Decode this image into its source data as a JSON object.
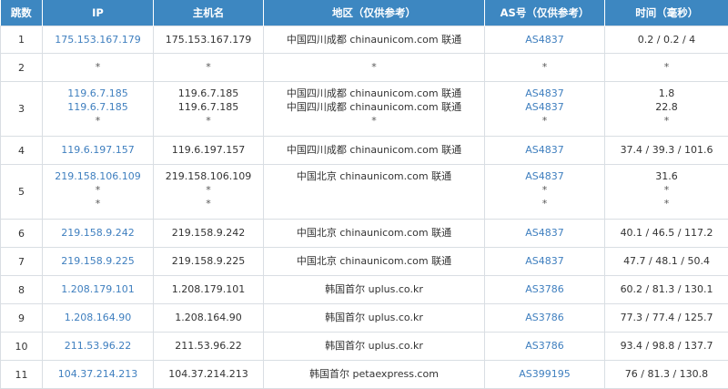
{
  "headers": {
    "hop": "跳数",
    "ip": "IP",
    "host": "主机名",
    "region": "地区（仅供参考）",
    "as": "AS号（仅供参考）",
    "time": "时间（毫秒）"
  },
  "rows": [
    {
      "hop": "1",
      "ip": [
        "175.153.167.179"
      ],
      "host": [
        "175.153.167.179"
      ],
      "region": [
        "中国四川成都 chinaunicom.com 联通"
      ],
      "as": [
        "AS4837"
      ],
      "time": [
        "0.2 / 0.2 / 4"
      ]
    },
    {
      "hop": "2",
      "ip": [
        "*"
      ],
      "host": [
        "*"
      ],
      "region": [
        "*"
      ],
      "as": [
        "*"
      ],
      "time": [
        "*"
      ]
    },
    {
      "hop": "3",
      "ip": [
        "119.6.7.185",
        "119.6.7.185",
        "*"
      ],
      "host": [
        "119.6.7.185",
        "119.6.7.185",
        "*"
      ],
      "region": [
        "中国四川成都 chinaunicom.com 联通",
        "中国四川成都 chinaunicom.com 联通",
        "*"
      ],
      "as": [
        "AS4837",
        "AS4837",
        "*"
      ],
      "time": [
        "1.8",
        "22.8",
        "*"
      ]
    },
    {
      "hop": "4",
      "ip": [
        "119.6.197.157"
      ],
      "host": [
        "119.6.197.157"
      ],
      "region": [
        "中国四川成都 chinaunicom.com 联通"
      ],
      "as": [
        "AS4837"
      ],
      "time": [
        "37.4 / 39.3 / 101.6"
      ]
    },
    {
      "hop": "5",
      "ip": [
        "219.158.106.109",
        "*",
        "*"
      ],
      "host": [
        "219.158.106.109",
        "*",
        "*"
      ],
      "region": [
        "中国北京 chinaunicom.com 联通"
      ],
      "as": [
        "AS4837",
        "*",
        "*"
      ],
      "time": [
        "31.6",
        "*",
        "*"
      ]
    },
    {
      "hop": "6",
      "ip": [
        "219.158.9.242"
      ],
      "host": [
        "219.158.9.242"
      ],
      "region": [
        "中国北京 chinaunicom.com 联通"
      ],
      "as": [
        "AS4837"
      ],
      "time": [
        "40.1 / 46.5 / 117.2"
      ]
    },
    {
      "hop": "7",
      "ip": [
        "219.158.9.225"
      ],
      "host": [
        "219.158.9.225"
      ],
      "region": [
        "中国北京 chinaunicom.com 联通"
      ],
      "as": [
        "AS4837"
      ],
      "time": [
        "47.7 / 48.1 / 50.4"
      ]
    },
    {
      "hop": "8",
      "ip": [
        "1.208.179.101"
      ],
      "host": [
        "1.208.179.101"
      ],
      "region": [
        "韩国首尔 uplus.co.kr"
      ],
      "as": [
        "AS3786"
      ],
      "time": [
        "60.2 / 81.3 / 130.1"
      ]
    },
    {
      "hop": "9",
      "ip": [
        "1.208.164.90"
      ],
      "host": [
        "1.208.164.90"
      ],
      "region": [
        "韩国首尔 uplus.co.kr"
      ],
      "as": [
        "AS3786"
      ],
      "time": [
        "77.3 / 77.4 / 125.7"
      ]
    },
    {
      "hop": "10",
      "ip": [
        "211.53.96.22"
      ],
      "host": [
        "211.53.96.22"
      ],
      "region": [
        "韩国首尔 uplus.co.kr"
      ],
      "as": [
        "AS3786"
      ],
      "time": [
        "93.4 / 98.8 / 137.7"
      ]
    },
    {
      "hop": "11",
      "ip": [
        "104.37.214.213"
      ],
      "host": [
        "104.37.214.213"
      ],
      "region": [
        "韩国首尔 petaexpress.com"
      ],
      "as": [
        "AS399195"
      ],
      "time": [
        "76 / 81.3 / 130.8"
      ]
    }
  ],
  "colors": {
    "header_bg": "#3d87c1",
    "link": "#3f7fbf",
    "border": "#d9dee3",
    "text": "#333333"
  }
}
